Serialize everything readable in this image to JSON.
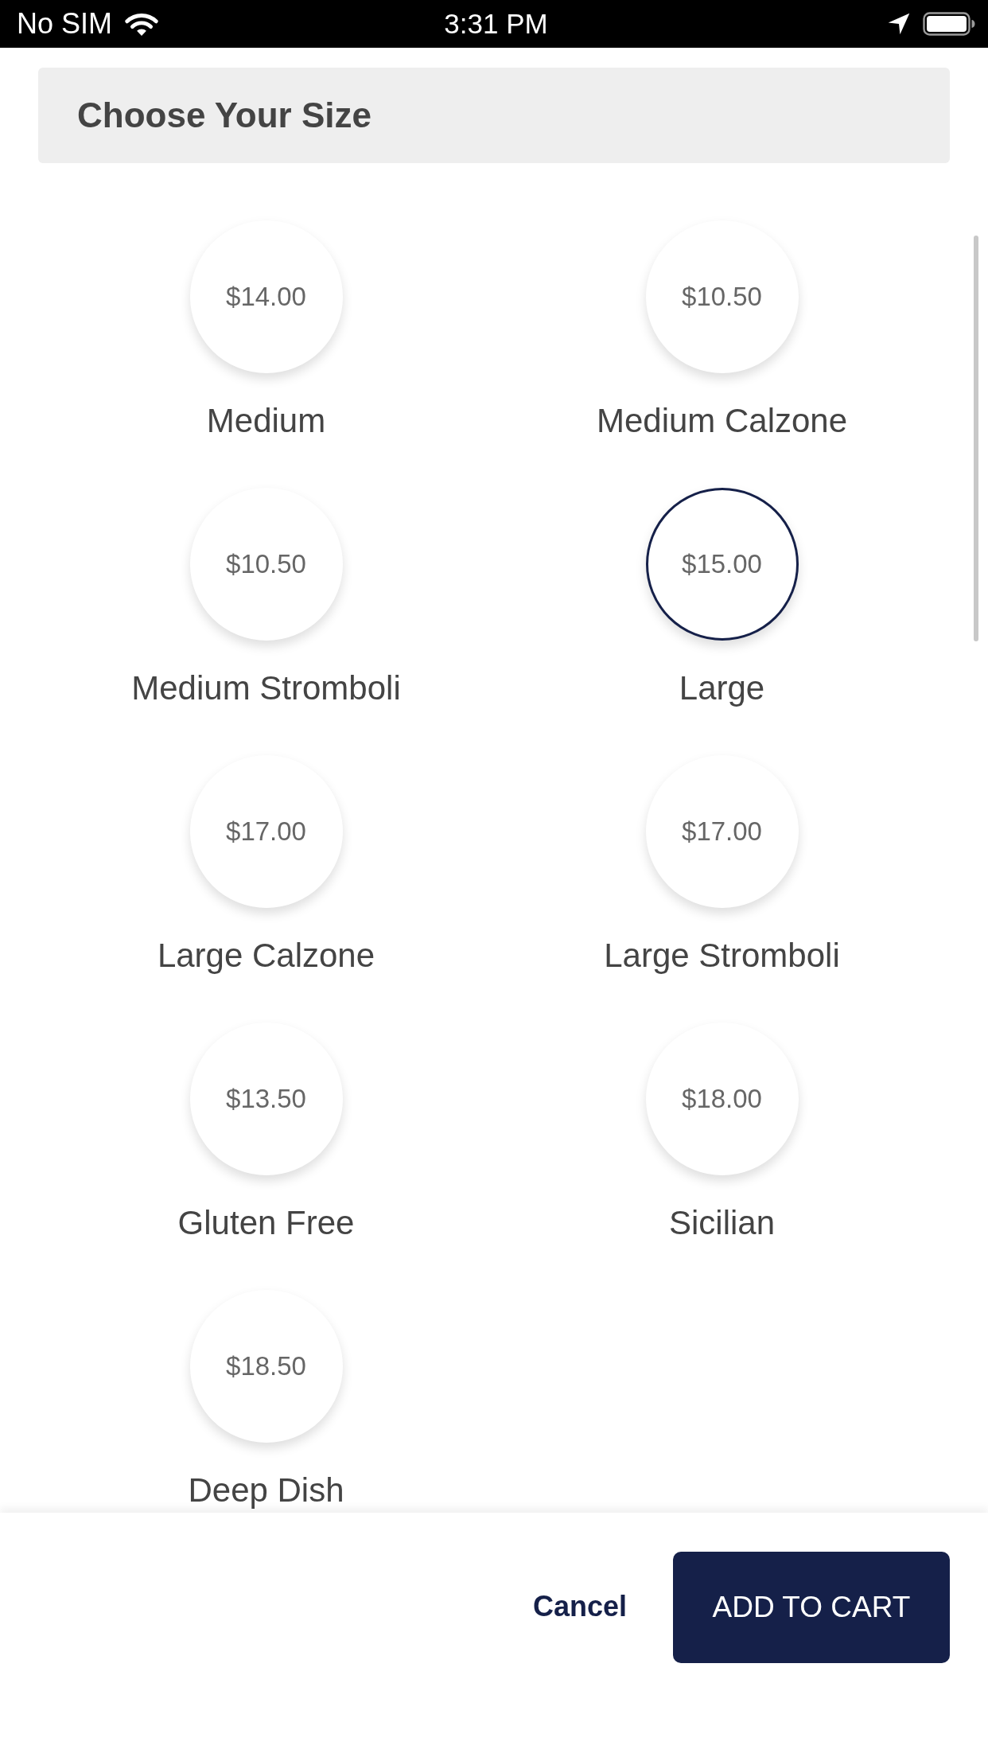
{
  "status_bar": {
    "carrier": "No SIM",
    "time": "3:31 PM"
  },
  "section": {
    "title": "Choose Your Size"
  },
  "sizes": [
    {
      "price": "$14.00",
      "name": "Medium",
      "selected": false
    },
    {
      "price": "$10.50",
      "name": "Medium Calzone",
      "selected": false
    },
    {
      "price": "$10.50",
      "name": "Medium Stromboli",
      "selected": false
    },
    {
      "price": "$15.00",
      "name": "Large",
      "selected": true
    },
    {
      "price": "$17.00",
      "name": "Large Calzone",
      "selected": false
    },
    {
      "price": "$17.00",
      "name": "Large Stromboli",
      "selected": false
    },
    {
      "price": "$13.50",
      "name": "Gluten Free",
      "selected": false
    },
    {
      "price": "$18.00",
      "name": "Sicilian",
      "selected": false
    },
    {
      "price": "$18.50",
      "name": "Deep Dish",
      "selected": false
    }
  ],
  "actions": {
    "cancel": "Cancel",
    "confirm": "ADD TO CART"
  }
}
